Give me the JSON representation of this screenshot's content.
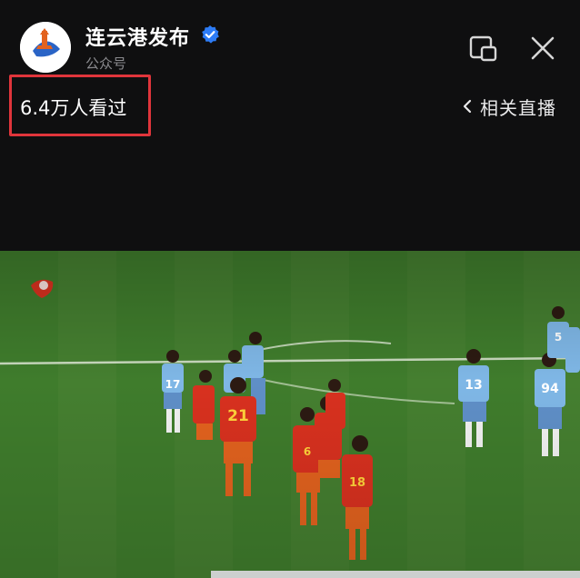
{
  "account": {
    "name": "连云港发布",
    "type": "公众号",
    "logo_text": "连云港发布"
  },
  "stats": {
    "views_label": "6.4万人看过"
  },
  "related": {
    "label": "相关直播"
  },
  "icons": {
    "verified": "verified-badge-icon",
    "pip": "picture-in-picture-icon",
    "close": "close-icon",
    "back": "chevron-left-icon",
    "broadcaster": "broadcaster-logo-icon"
  },
  "video": {
    "players_light": [
      {
        "number": "17"
      },
      {
        "number": "13"
      },
      {
        "number": "94"
      },
      {
        "number": "5"
      }
    ],
    "players_red": [
      {
        "number": "21"
      },
      {
        "number": "18"
      },
      {
        "number": "6"
      }
    ]
  },
  "colors": {
    "background": "#0f0f10",
    "highlight_border": "#e0353b",
    "verified_blue": "#2d7cf6",
    "team_light": "#7fb7e6",
    "team_red": "#d8311f",
    "pitch_green": "#427e2e"
  }
}
